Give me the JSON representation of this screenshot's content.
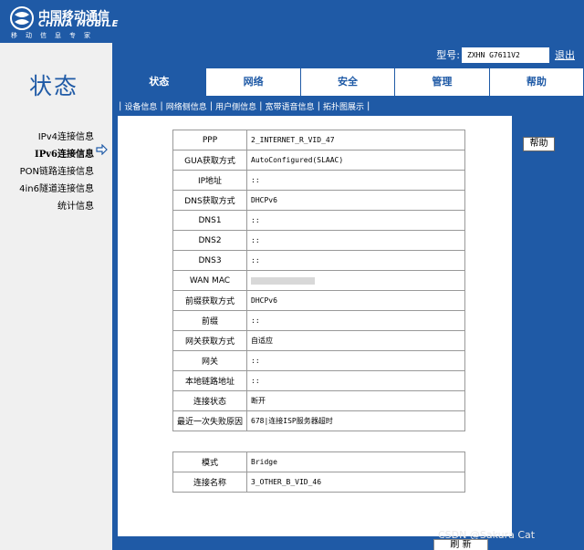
{
  "brand": {
    "name_cn": "中国移动通信",
    "name_en": "CHINA MOBILE",
    "slogan": "移动信息专家"
  },
  "header": {
    "model_label": "型号:",
    "model_value": "ZXHN G7611V2",
    "logout": "退出"
  },
  "page_title": "状态",
  "tabs": [
    {
      "label": "状态",
      "active": true
    },
    {
      "label": "网络",
      "active": false
    },
    {
      "label": "安全",
      "active": false
    },
    {
      "label": "管理",
      "active": false
    },
    {
      "label": "帮助",
      "active": false
    }
  ],
  "subnav": [
    "设备信息",
    "网络侧信息",
    "用户侧信息",
    "宽带语音信息",
    "拓扑图展示"
  ],
  "left_menu": [
    "IPv4连接信息",
    "IPv6连接信息",
    "PON链路连接信息",
    "4in6隧道连接信息",
    "统计信息"
  ],
  "help_button": "帮助",
  "table1": [
    {
      "k": "PPP",
      "v": "2_INTERNET_R_VID_47"
    },
    {
      "k": "GUA获取方式",
      "v": "AutoConfigured(SLAAC)"
    },
    {
      "k": "IP地址",
      "v": "::"
    },
    {
      "k": "DNS获取方式",
      "v": "DHCPv6"
    },
    {
      "k": "DNS1",
      "v": "::"
    },
    {
      "k": "DNS2",
      "v": "::"
    },
    {
      "k": "DNS3",
      "v": "::"
    },
    {
      "k": "WAN MAC",
      "v": ""
    },
    {
      "k": "前缀获取方式",
      "v": "DHCPv6"
    },
    {
      "k": "前缀",
      "v": "::"
    },
    {
      "k": "网关获取方式",
      "v": "自适应"
    },
    {
      "k": "网关",
      "v": "::"
    },
    {
      "k": "本地链路地址",
      "v": "::"
    },
    {
      "k": "连接状态",
      "v": "断开"
    },
    {
      "k": "最近一次失败原因",
      "v": "678|连接ISP服务器超时"
    }
  ],
  "table2": [
    {
      "k": "模式",
      "v": "Bridge"
    },
    {
      "k": "连接名称",
      "v": "3_OTHER_B_VID_46"
    }
  ],
  "refresh_button": "刷 新",
  "watermark": "CSDN @Sakura Cat"
}
